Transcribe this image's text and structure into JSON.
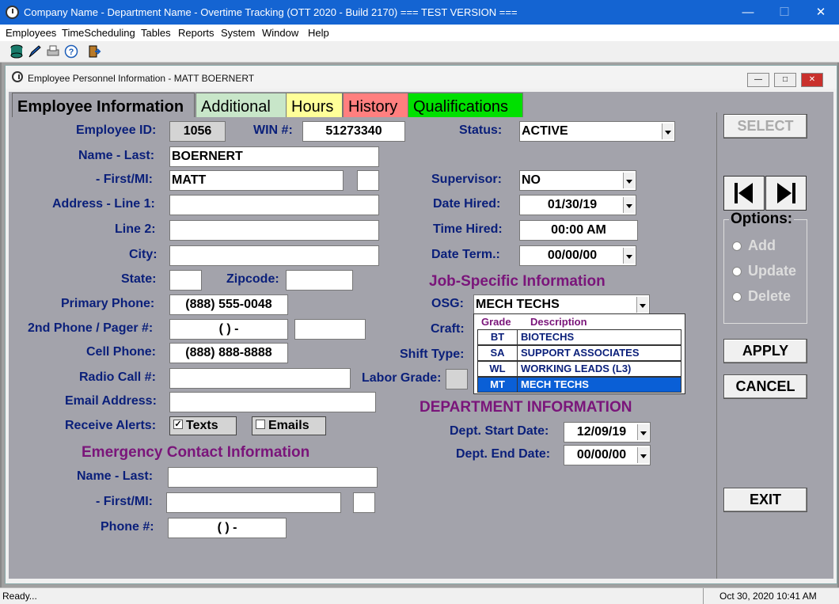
{
  "window": {
    "title": "Company Name - Department Name - Overtime Tracking (OTT 2020 - Build 2170) === TEST VERSION ==="
  },
  "menu": [
    "Employees",
    "TimeScheduling",
    "Tables",
    "Reports",
    "System",
    "Window",
    "Help"
  ],
  "child": {
    "title": "Employee Personnel Information - MATT BOERNERT"
  },
  "tabs": [
    {
      "label": "Employee Information",
      "color": "#a3a3ab"
    },
    {
      "label": "Additional",
      "color": "#c8e6c9"
    },
    {
      "label": "Hours",
      "color": "#ffff99"
    },
    {
      "label": "History",
      "color": "#ff7f7f"
    },
    {
      "label": "Qualifications",
      "color": "#00e000"
    }
  ],
  "labels": {
    "employee_id": "Employee ID:",
    "win": "WIN #:",
    "status": "Status:",
    "name_last": "Name - Last:",
    "first_mi": "- First/MI:",
    "address1": "Address - Line 1:",
    "line2": "Line 2:",
    "city": "City:",
    "state": "State:",
    "zipcode": "Zipcode:",
    "primary_phone": "Primary Phone:",
    "second_phone": "2nd Phone / Pager #:",
    "cell_phone": "Cell Phone:",
    "radio_call": "Radio Call #:",
    "email": "Email Address:",
    "alerts": "Receive Alerts:",
    "supervisor": "Supervisor:",
    "date_hired": "Date Hired:",
    "time_hired": "Time Hired:",
    "date_term": "Date Term.:",
    "osg": "OSG:",
    "craft": "Craft:",
    "shift_type": "Shift Type:",
    "labor_grade": "Labor Grade:",
    "dept_start": "Dept. Start Date:",
    "dept_end": "Dept. End Date:",
    "ec_name_last": "Name - Last:",
    "ec_first_mi": "- First/MI:",
    "ec_phone": "Phone #:"
  },
  "values": {
    "employee_id": "1056",
    "win": "51273340",
    "status": "ACTIVE",
    "name_last": "BOERNERT",
    "first": "MATT",
    "mi": "",
    "address1": "",
    "line2": "",
    "city": "",
    "state": "",
    "zipcode": "",
    "primary_phone": "(888) 555-0048",
    "second_phone": "(   )    -",
    "second_phone_ext": "",
    "cell_phone": "(888) 888-8888",
    "radio_call": "",
    "email": "",
    "supervisor": "NO",
    "date_hired": "01/30/19",
    "time_hired": "00:00 AM",
    "date_term": "00/00/00",
    "osg": "MECH TECHS",
    "dept_start": "12/09/19",
    "dept_end": "00/00/00",
    "ec_name_last": "",
    "ec_first": "",
    "ec_mi": "",
    "ec_phone": "(   )    -"
  },
  "alerts": {
    "texts": "Texts",
    "texts_checked": "✓",
    "emails": "Emails"
  },
  "sections": {
    "job": "Job-Specific  Information",
    "dept": "DEPARTMENT INFORMATION",
    "emergency": "Emergency Contact Information"
  },
  "osg_list": {
    "headers": {
      "grade": "Grade",
      "description": "Description"
    },
    "rows": [
      {
        "grade": "BT",
        "description": "BIOTECHS"
      },
      {
        "grade": "SA",
        "description": "SUPPORT ASSOCIATES"
      },
      {
        "grade": "WL",
        "description": "WORKING LEADS (L3)"
      },
      {
        "grade": "MT",
        "description": "MECH TECHS"
      }
    ],
    "selected": "MT"
  },
  "buttons": {
    "select": "SELECT",
    "apply": "APPLY",
    "cancel": "CANCEL",
    "exit": "EXIT"
  },
  "options": {
    "title": "Options:",
    "items": [
      "Add",
      "Update",
      "Delete"
    ]
  },
  "status": {
    "text": "Ready...",
    "datetime": "Oct 30, 2020   10:41 AM"
  }
}
